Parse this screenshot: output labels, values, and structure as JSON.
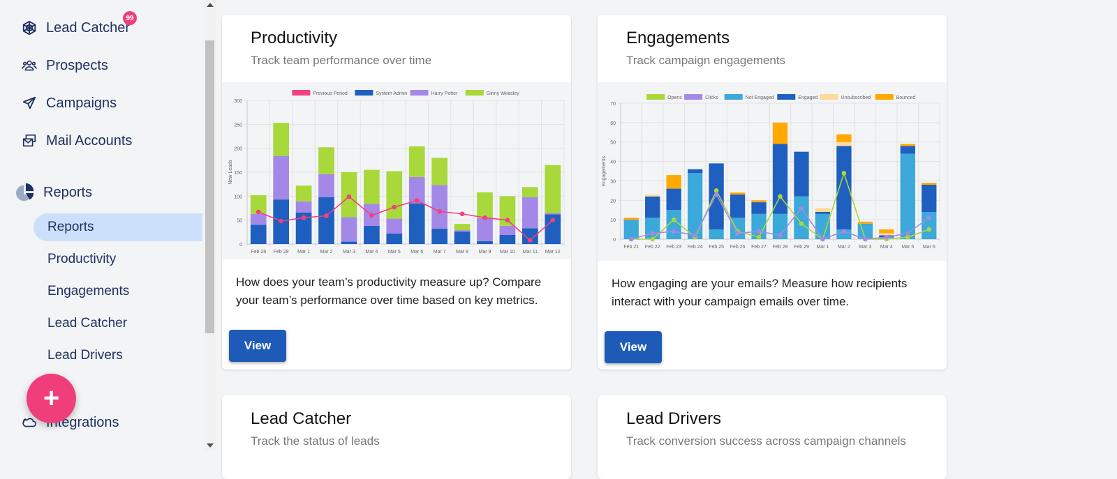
{
  "sidebar": {
    "items": [
      {
        "label": "Lead Catcher",
        "icon": "web-icon",
        "badge": "99"
      },
      {
        "label": "Prospects",
        "icon": "users-icon"
      },
      {
        "label": "Campaigns",
        "icon": "paper-plane-icon"
      },
      {
        "label": "Mail Accounts",
        "icon": "mail-accounts-icon"
      },
      {
        "label": "Reports",
        "icon": "pie-chart-icon"
      },
      {
        "label": "Integrations",
        "icon": "cloud-icon"
      }
    ],
    "subitems": [
      {
        "label": "Reports",
        "active": true
      },
      {
        "label": "Productivity"
      },
      {
        "label": "Engagements"
      },
      {
        "label": "Lead Catcher"
      },
      {
        "label": "Lead Drivers"
      }
    ],
    "fab_label": "+"
  },
  "cards": [
    {
      "title": "Productivity",
      "subtitle": "Track team performance over time",
      "description": "How does your team’s productivity measure up? Compare your team’s performance over time based on key metrics.",
      "button": "View"
    },
    {
      "title": "Engagements",
      "subtitle": "Track campaign engagements",
      "description": "How engaging are your emails? Measure how recipients interact with your campaign emails over time.",
      "button": "View"
    },
    {
      "title": "Lead Catcher",
      "subtitle": "Track the status of leads"
    },
    {
      "title": "Lead Drivers",
      "subtitle": "Track conversion success across campaign channels"
    }
  ],
  "chart_data": [
    {
      "type": "bar",
      "stacked": true,
      "title": "",
      "ylabel": "New Leads",
      "xlabel": "",
      "ylim": [
        0,
        300
      ],
      "yticks": [
        0,
        50,
        100,
        150,
        200,
        250,
        300
      ],
      "legend_position": "top",
      "categories": [
        "Feb 28",
        "Feb 29",
        "Mar 1",
        "Mar 2",
        "Mar 3",
        "Mar 4",
        "Mar 5",
        "Mar 6",
        "Mar 7",
        "Mar 8",
        "Mar 9",
        "Mar 10",
        "Mar 11",
        "Mar 12"
      ],
      "series": [
        {
          "name": "Previous Period",
          "type": "line",
          "color": "#f43f7f",
          "values": [
            67,
            48,
            55,
            59,
            99,
            60,
            77,
            91,
            68,
            63,
            55,
            50,
            8,
            50
          ]
        },
        {
          "name": "System Admin",
          "type": "bar",
          "color": "#1f5fbf",
          "values": [
            40,
            93,
            66,
            98,
            5,
            38,
            22,
            85,
            32,
            26,
            6,
            19,
            33,
            62
          ]
        },
        {
          "name": "Harry Potter",
          "type": "bar",
          "color": "#a488e8",
          "values": [
            23,
            91,
            23,
            48,
            51,
            46,
            31,
            55,
            91,
            3,
            48,
            19,
            65,
            3
          ]
        },
        {
          "name": "Ginny Weasley",
          "type": "bar",
          "color": "#a8d83a",
          "values": [
            39,
            69,
            33,
            56,
            94,
            71,
            99,
            64,
            57,
            13,
            54,
            62,
            21,
            100
          ]
        }
      ]
    },
    {
      "type": "bar",
      "stacked": true,
      "title": "",
      "ylabel": "Engagements",
      "xlabel": "",
      "ylim": [
        0,
        70
      ],
      "yticks": [
        0,
        10,
        20,
        30,
        40,
        50,
        60,
        70
      ],
      "legend_position": "top",
      "categories": [
        "Feb 21",
        "Feb 22",
        "Feb 23",
        "Feb 24",
        "Feb 25",
        "Feb 26",
        "Feb 27",
        "Feb 28",
        "Feb 29",
        "Mar 1",
        "Mar 2",
        "Mar 3",
        "Mar 4",
        "Mar 5",
        "Mar 6"
      ],
      "series": [
        {
          "name": "Opens",
          "type": "line",
          "color": "#a8d83a",
          "values": [
            0,
            0,
            10,
            1,
            25,
            4,
            1,
            22,
            8,
            0,
            34,
            0,
            0,
            1,
            5
          ]
        },
        {
          "name": "Clicks",
          "type": "line",
          "color": "#a488e8",
          "values": [
            0,
            3,
            4,
            2,
            23,
            3,
            4,
            2,
            16,
            0,
            4,
            0,
            1,
            3,
            11
          ]
        },
        {
          "name": "Not Engaged",
          "type": "bar",
          "color": "#3ba9d9",
          "values": [
            10,
            11,
            15,
            34,
            5,
            11,
            13,
            13,
            22,
            13,
            5,
            8,
            1,
            44,
            14
          ]
        },
        {
          "name": "Engaged",
          "type": "bar",
          "color": "#1f5fbf",
          "values": [
            0,
            11,
            11,
            2,
            34,
            12,
            6,
            36,
            23,
            1,
            43,
            0,
            1,
            4,
            14
          ]
        },
        {
          "name": "Unsubscribed",
          "type": "bar",
          "color": "#fdd99a",
          "values": [
            0,
            1,
            0,
            0,
            0,
            0,
            0,
            0,
            0,
            2,
            2,
            0,
            1,
            0,
            0
          ]
        },
        {
          "name": "Bounced",
          "type": "bar",
          "color": "#ffa800",
          "values": [
            1,
            0,
            7,
            0,
            0,
            1,
            1,
            11,
            0,
            0,
            4,
            1,
            2,
            1,
            1
          ]
        }
      ]
    }
  ]
}
